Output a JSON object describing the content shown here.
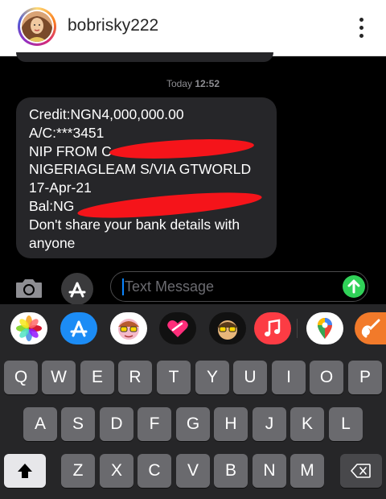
{
  "header": {
    "username": "bobrisky222",
    "avatar_icon": "profile-avatar",
    "more_icon": "more-options-icon"
  },
  "conversation": {
    "timestamp_day": "Today",
    "timestamp_time": "12:52",
    "message_lines": [
      "Credit:NGN4,000,000.00",
      "A/C:***3451",
      "NIP FROM C",
      "NIGERIAGLEAM S/VIA GTWORLD",
      "17-Apr-21",
      "Bal:NG",
      "Don't share your bank details with",
      "anyone"
    ],
    "redaction_color": "#f5141a"
  },
  "input_bar": {
    "placeholder": "Text Message",
    "camera_icon": "camera-icon",
    "apps_icon": "app-store-icon",
    "send_icon": "send-arrow-icon",
    "send_color": "#30d158"
  },
  "app_drawer": {
    "apps": [
      "photos",
      "app-store",
      "memoji-stickers",
      "digital-touch",
      "memoji",
      "music",
      "google-maps",
      "garageband"
    ]
  },
  "keyboard": {
    "row1": [
      "Q",
      "W",
      "E",
      "R",
      "T",
      "Y",
      "U",
      "I",
      "O",
      "P"
    ],
    "row2": [
      "A",
      "S",
      "D",
      "F",
      "G",
      "H",
      "J",
      "K",
      "L"
    ],
    "row3": [
      "Z",
      "X",
      "C",
      "V",
      "B",
      "N",
      "M"
    ],
    "shift_icon": "shift-icon",
    "delete_icon": "backspace-icon"
  }
}
